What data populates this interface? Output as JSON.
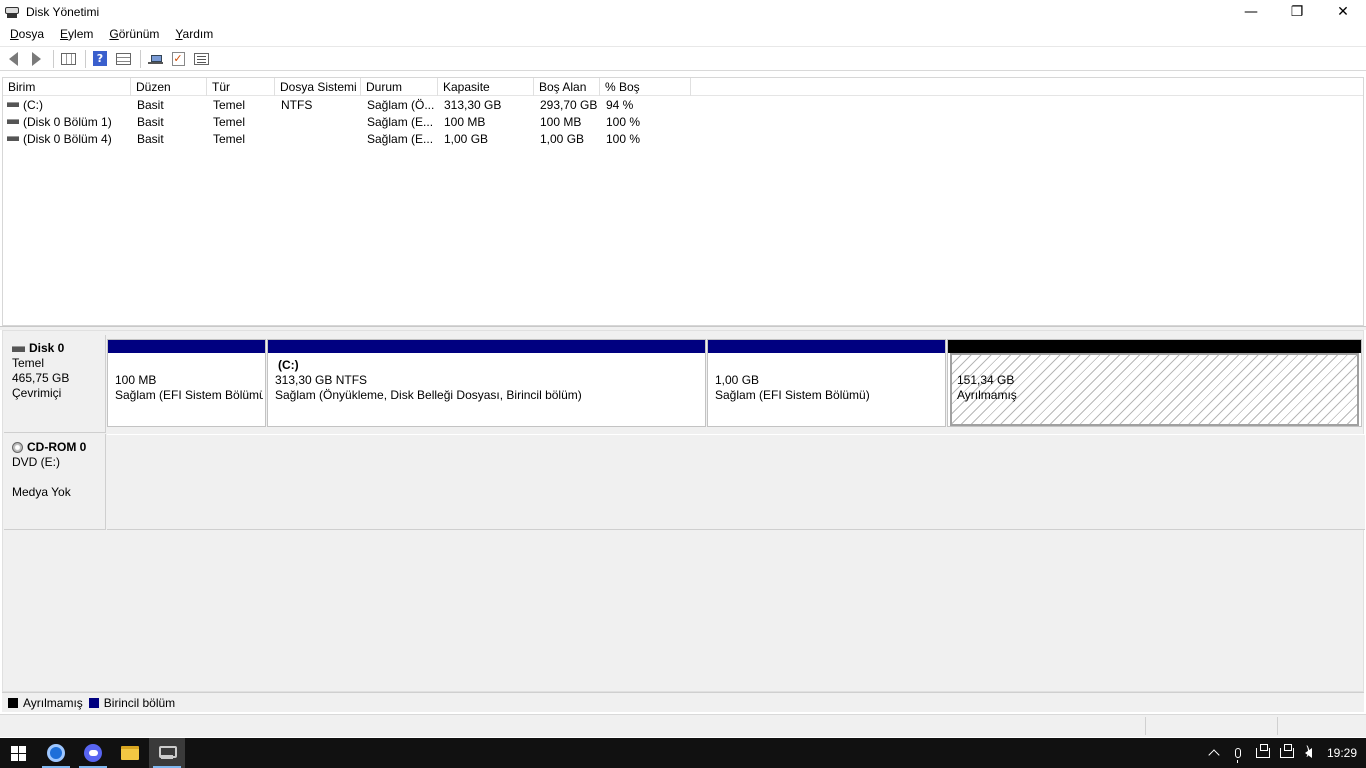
{
  "window": {
    "title": "Disk Yönetimi",
    "controls": {
      "minimize": "—",
      "maximize": "❐",
      "close": "✕"
    }
  },
  "menu": [
    {
      "label": "Dosya"
    },
    {
      "label": "Eylem"
    },
    {
      "label": "Görünüm"
    },
    {
      "label": "Yardım"
    }
  ],
  "toolbar": {
    "icons": [
      "back-icon",
      "forward-icon",
      "disk-list-icon",
      "help-icon",
      "volume-list-icon",
      "connect-icon",
      "check-icon",
      "properties-icon"
    ],
    "help_glyph": "?",
    "check_glyph": "✓"
  },
  "volume_list": {
    "columns": [
      "Birim",
      "Düzen",
      "Tür",
      "Dosya Sistemi",
      "Durum",
      "Kapasite",
      "Boş Alan",
      "% Boş"
    ],
    "rows": [
      {
        "name": "(C:)",
        "layout": "Basit",
        "type": "Temel",
        "fs": "NTFS",
        "status": "Sağlam (Ö...",
        "capacity": "313,30 GB",
        "free": "293,70 GB",
        "pct": "94 %"
      },
      {
        "name": "(Disk 0 Bölüm 1)",
        "layout": "Basit",
        "type": "Temel",
        "fs": "",
        "status": "Sağlam (E...",
        "capacity": "100 MB",
        "free": "100 MB",
        "pct": "100 %"
      },
      {
        "name": "(Disk 0 Bölüm 4)",
        "layout": "Basit",
        "type": "Temel",
        "fs": "",
        "status": "Sağlam (E...",
        "capacity": "1,00 GB",
        "free": "1,00 GB",
        "pct": "100 %"
      }
    ]
  },
  "disks": [
    {
      "name": "Disk 0",
      "type": "Temel",
      "size": "465,75 GB",
      "state": "Çevrimiçi",
      "partitions": [
        {
          "name": "",
          "line1": "100 MB",
          "line2": "Sağlam (EFI Sistem Bölümü)",
          "kind": "primary"
        },
        {
          "name": "(C:)",
          "line1": "313,30 GB NTFS",
          "line2": "Sağlam (Önyükleme, Disk Belleği Dosyası, Birincil bölüm)",
          "kind": "primary"
        },
        {
          "name": "",
          "line1": "1,00 GB",
          "line2": "Sağlam (EFI Sistem Bölümü)",
          "kind": "primary"
        },
        {
          "name": "",
          "line1": "151,34 GB",
          "line2": "Ayrılmamış",
          "kind": "unallocated"
        }
      ]
    },
    {
      "name": "CD-ROM 0",
      "type": "DVD (E:)",
      "state": "Medya Yok"
    }
  ],
  "legend": [
    {
      "label": "Ayrılmamış",
      "color": "#000000"
    },
    {
      "label": "Birincil bölüm",
      "color": "#000080"
    }
  ],
  "colors": {
    "primary": "#000080",
    "unallocated": "#000000"
  },
  "taskbar": {
    "apps": [
      "windows-start-icon",
      "chrome-icon",
      "discord-icon",
      "file-explorer-icon",
      "disk-management-icon"
    ],
    "clock": "19:29"
  }
}
